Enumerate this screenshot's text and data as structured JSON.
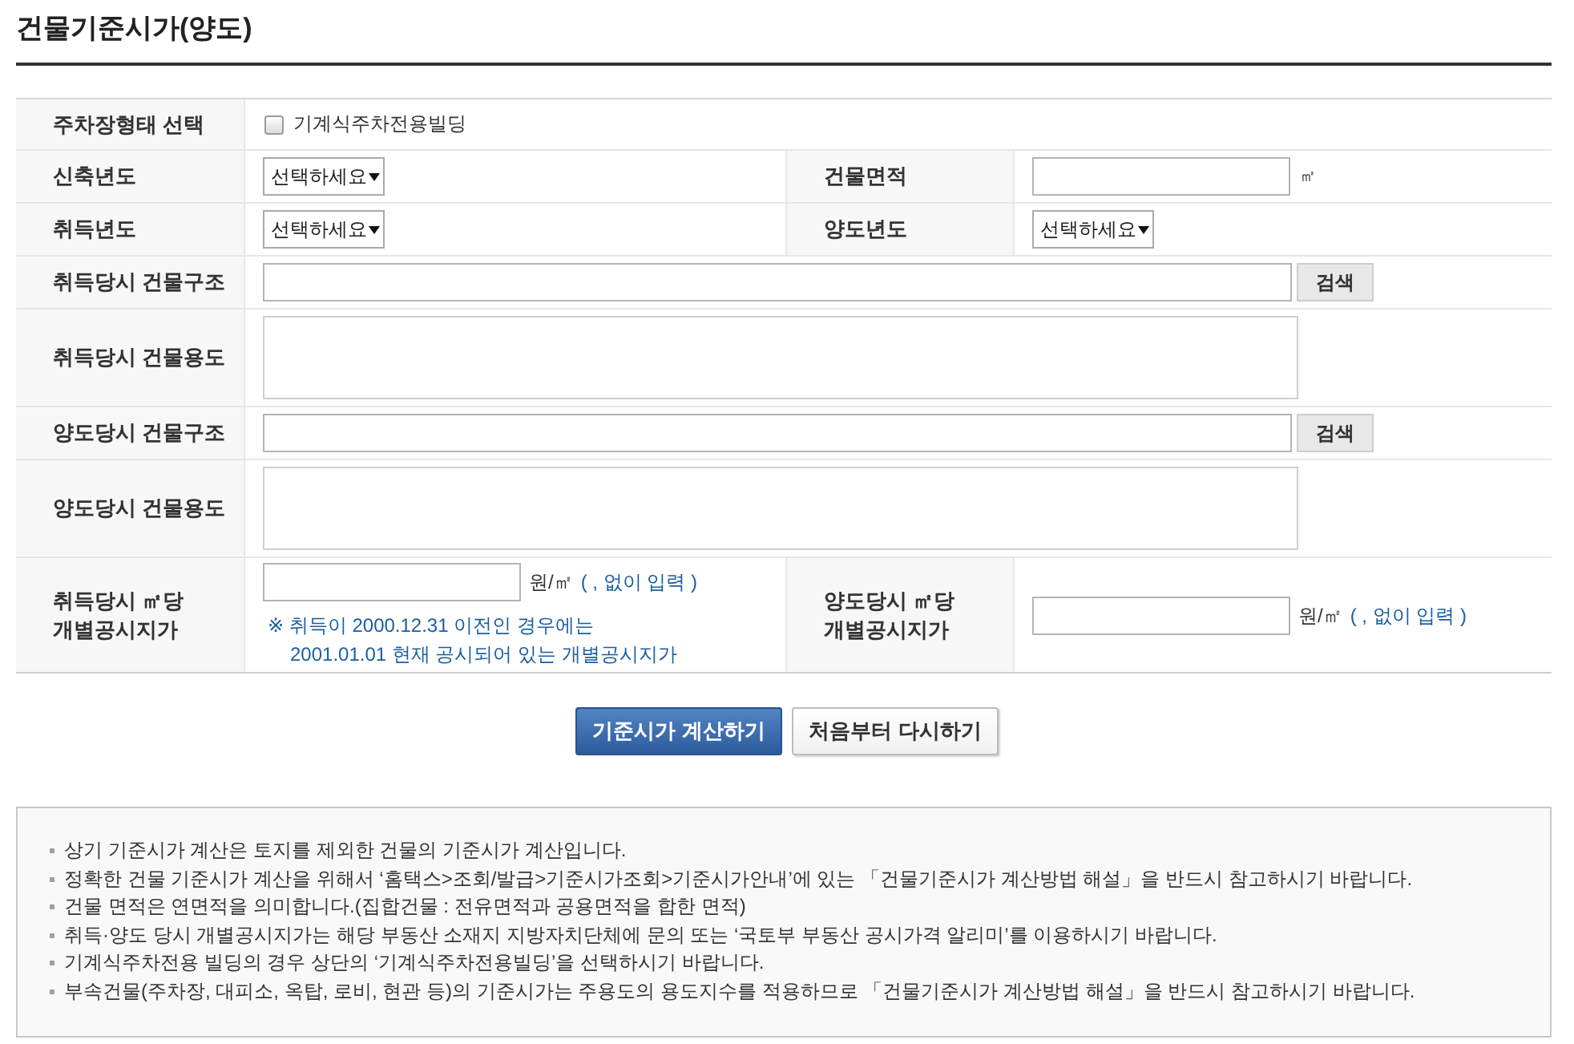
{
  "title": "건물기준시가(양도)",
  "form": {
    "rows": [
      {
        "fields": [
          {
            "kind": "checkbox",
            "label": "주차장형태 선택",
            "option": "기계식주차전용빌딩",
            "checked": false
          }
        ]
      },
      {
        "fields": [
          {
            "kind": "select",
            "label": "신축년도",
            "value": "선택하세요"
          },
          {
            "kind": "input",
            "label": "건물면적",
            "unit": "㎡"
          }
        ]
      },
      {
        "fields": [
          {
            "kind": "select",
            "label": "취득년도",
            "value": "선택하세요"
          },
          {
            "kind": "select",
            "label": "양도년도",
            "value": "선택하세요"
          }
        ]
      },
      {
        "fields": [
          {
            "kind": "search",
            "label": "취득당시 건물구조",
            "button": "검색"
          }
        ]
      },
      {
        "fields": [
          {
            "kind": "textarea",
            "label": "취득당시 건물용도"
          }
        ]
      },
      {
        "fields": [
          {
            "kind": "search",
            "label": "양도당시 건물구조",
            "button": "검색"
          }
        ]
      },
      {
        "fields": [
          {
            "kind": "textarea",
            "label": "양도당시 건물용도"
          }
        ]
      },
      {
        "fields": [
          {
            "kind": "price",
            "label": "취득당시 ㎡당\n개별공시지가",
            "unit": "원/㎡",
            "hint": "( , 없이 입력 )",
            "note": "※ 취득이 2000.12.31 이전인 경우에는\n2001.01.01 현재 공시되어 있는 개별공시지가"
          },
          {
            "kind": "price",
            "label": "양도당시 ㎡당\n개별공시지가",
            "unit": "원/㎡",
            "hint": "( , 없이 입력 )"
          }
        ]
      }
    ]
  },
  "buttons": [
    {
      "kind": "primary",
      "label": "기준시가 계산하기"
    },
    {
      "kind": "secondary",
      "label": "처음부터 다시하기"
    }
  ],
  "notes": [
    "상기 기준시가 계산은 토지를 제외한 건물의 기준시가 계산입니다.",
    "정확한 건물 기준시가 계산을 위해서 ‘홈택스>조회/발급>기준시가조회>기준시가안내’에 있는 「건물기준시가 계산방법 해설」을 반드시 참고하시기 바랍니다.",
    "건물 면적은 연면적을 의미합니다.(집합건물 : 전유면적과 공용면적을 합한 면적)",
    "취득·양도 당시 개별공시지가는 해당 부동산 소재지 지방자치단체에 문의 또는 ‘국토부 부동산 공시가격 알리미’를 이용하시기 바랍니다.",
    "기계식주차전용 빌딩의 경우 상단의 ‘기계식주차전용빌딩’을 선택하시기 바랍니다.",
    "부속건물(주차장, 대피소, 옥탑, 로비, 현관 등)의 기준시가는 주용도의 용도지수를 적용하므로 「건물기준시가 계산방법 해설」을 반드시 참고하시기 바랍니다."
  ]
}
